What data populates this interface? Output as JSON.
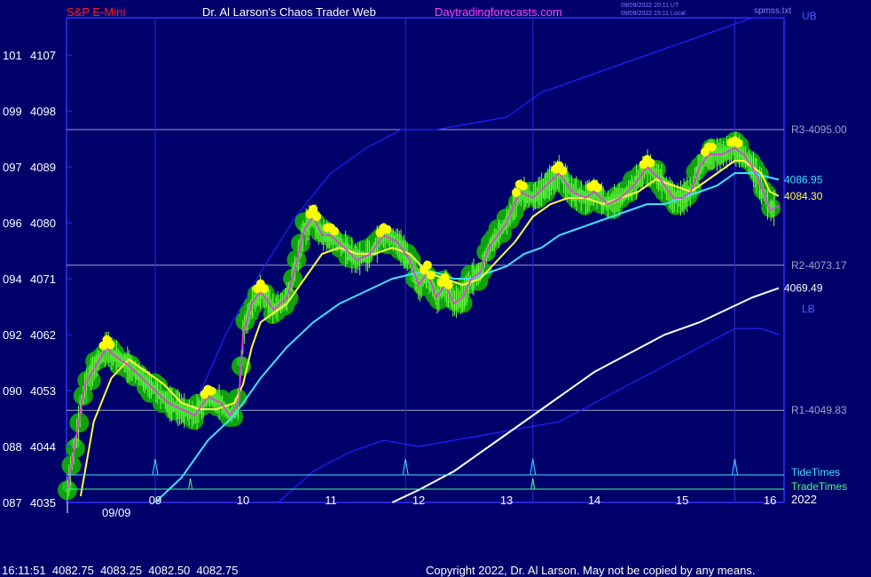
{
  "header": {
    "instrument": "S&P E-Mini",
    "site_title": "Dr. Al Larson's Chaos Trader Web",
    "site_url": "Daytradingforecasts.com",
    "timestamp_ut": "09/09/2022 20:11 UT",
    "timestamp_local": "09/09/2022 15:11 Local",
    "file_name": "spmss.txt",
    "colors": {
      "instrument": "#ff2020",
      "site_title": "#ffffff",
      "site_url": "#ff40ff",
      "timestamps": "#8080ff"
    }
  },
  "footer": {
    "quote": "16:11:51  4082.75  4083.25  4082.50  4082.75",
    "copyright": "Copyright 2022, Dr. Al Larson. May not be copied by any means."
  },
  "chart_data": {
    "type": "line",
    "title": "S&P E-Mini",
    "y_axis": {
      "range": [
        4035,
        4113
      ],
      "tick_labels": [
        {
          "left": "087",
          "price": "4035",
          "value": 4035
        },
        {
          "left": "088",
          "price": "4044",
          "value": 4044
        },
        {
          "left": "090",
          "price": "4053",
          "value": 4053
        },
        {
          "left": "092",
          "price": "4062",
          "value": 4062
        },
        {
          "left": "094",
          "price": "4071",
          "value": 4071
        },
        {
          "left": "096",
          "price": "4080",
          "value": 4080
        },
        {
          "left": "097",
          "price": "4089",
          "value": 4089
        },
        {
          "left": "099",
          "price": "4098",
          "value": 4098
        },
        {
          "left": "101",
          "price": "4107",
          "value": 4107
        }
      ]
    },
    "x_axis": {
      "range": [
        8.0,
        16.1
      ],
      "unit": "hour",
      "tick_labels": [
        {
          "label": "09",
          "value": 9
        },
        {
          "label": "10",
          "value": 10
        },
        {
          "label": "11",
          "value": 11
        },
        {
          "label": "12",
          "value": 12
        },
        {
          "label": "13",
          "value": 13
        },
        {
          "label": "14",
          "value": 14
        },
        {
          "label": "15",
          "value": 15
        },
        {
          "label": "16",
          "value": 16
        }
      ],
      "date_label": "09/09",
      "year_label": "2022"
    },
    "levels": [
      {
        "label": "R3-4095.00",
        "value": 4095.0
      },
      {
        "label": "R2-4073.17",
        "value": 4073.17
      },
      {
        "label": "R1-4049.83",
        "value": 4049.83
      }
    ],
    "vertical_markers": [
      9.0,
      11.85,
      13.3,
      15.6
    ],
    "tide_times": [
      9.0,
      11.85,
      13.3,
      15.6
    ],
    "trade_times": [
      9.4,
      13.3
    ],
    "band_labels": {
      "upper": "UB",
      "lower": "LB"
    },
    "row_labels": {
      "tide": "TideTimes",
      "trade": "TradeTimes"
    },
    "end_values": [
      {
        "label": "4086.95",
        "value": 4086.95,
        "series": "cyan_average"
      },
      {
        "label": "4084.30",
        "value": 4084.3,
        "series": "yellow_average"
      },
      {
        "label": "4069.49",
        "value": 4069.49,
        "series": "white_line"
      }
    ],
    "series": [
      {
        "key": "price",
        "color": "#e040e0",
        "x": [
          8.0,
          8.2,
          8.45,
          8.5,
          8.7,
          8.85,
          9.0,
          9.15,
          9.3,
          9.45,
          9.6,
          9.75,
          9.85,
          9.95,
          10.0,
          10.1,
          10.2,
          10.35,
          10.5,
          10.6,
          10.7,
          10.8,
          10.9,
          11.0,
          11.15,
          11.3,
          11.45,
          11.6,
          11.75,
          11.9,
          12.0,
          12.1,
          12.2,
          12.3,
          12.4,
          12.5,
          12.6,
          12.7,
          12.8,
          12.9,
          13.0,
          13.15,
          13.3,
          13.45,
          13.6,
          13.75,
          13.9,
          14.0,
          14.15,
          14.3,
          14.45,
          14.6,
          14.75,
          14.9,
          15.0,
          15.1,
          15.2,
          15.3,
          15.45,
          15.6,
          15.7,
          15.8,
          15.9,
          16.0,
          16.1
        ],
        "values": [
          4037,
          4054,
          4060,
          4059,
          4057,
          4055,
          4053,
          4051,
          4050,
          4049,
          4052,
          4051,
          4049,
          4051,
          4062,
          4067,
          4069,
          4066,
          4068,
          4073,
          4079,
          4081,
          4078,
          4078,
          4076,
          4074,
          4075,
          4078,
          4077,
          4074,
          4070,
          4072,
          4068,
          4070,
          4067,
          4068,
          4071,
          4072,
          4076,
          4078,
          4080,
          4085,
          4084,
          4086,
          4088,
          4085,
          4084,
          4085,
          4083,
          4084,
          4086,
          4089,
          4087,
          4084,
          4084,
          4085,
          4089,
          4091,
          4091,
          4092,
          4091,
          4089,
          4086,
          4082,
          4082.75
        ]
      },
      {
        "key": "yellow_average",
        "color": "#ffff40",
        "x": [
          8.15,
          8.3,
          8.5,
          8.7,
          8.9,
          9.1,
          9.3,
          9.5,
          9.7,
          9.9,
          10.0,
          10.1,
          10.2,
          10.4,
          10.5,
          10.7,
          10.9,
          11.1,
          11.3,
          11.5,
          11.7,
          11.9,
          12.1,
          12.3,
          12.5,
          12.7,
          12.9,
          13.1,
          13.3,
          13.5,
          13.7,
          13.9,
          14.1,
          14.3,
          14.5,
          14.7,
          14.9,
          15.1,
          15.3,
          15.5,
          15.6,
          15.7,
          15.8,
          15.9,
          16.0,
          16.1
        ],
        "values": [
          4036,
          4048,
          4055,
          4058,
          4056,
          4054,
          4051,
          4050,
          4050,
          4051,
          4054,
          4060,
          4064,
          4066,
          4067,
          4071,
          4075,
          4076,
          4075,
          4075,
          4076,
          4075,
          4072,
          4071,
          4070,
          4071,
          4074,
          4077,
          4081,
          4083,
          4084,
          4084,
          4083,
          4084,
          4085,
          4087,
          4086,
          4085,
          4087,
          4089,
          4090,
          4090,
          4089,
          4088,
          4085,
          4084.3
        ]
      },
      {
        "key": "cyan_average",
        "color": "#40e0ff",
        "x": [
          9.0,
          9.3,
          9.6,
          9.9,
          10.2,
          10.5,
          10.8,
          11.1,
          11.4,
          11.7,
          12.0,
          12.2,
          12.4,
          12.6,
          12.8,
          13.0,
          13.2,
          13.4,
          13.6,
          13.8,
          14.0,
          14.2,
          14.4,
          14.6,
          14.8,
          15.0,
          15.2,
          15.4,
          15.6,
          15.8,
          16.1
        ],
        "values": [
          4035,
          4039,
          4045,
          4049,
          4055,
          4060,
          4064,
          4067,
          4069,
          4071,
          4072,
          4072,
          4071,
          4071,
          4072,
          4073,
          4075,
          4076,
          4078,
          4079,
          4080,
          4081,
          4082,
          4083,
          4083,
          4084,
          4085,
          4086,
          4088,
          4088,
          4086.95
        ]
      },
      {
        "key": "white_line",
        "color": "#ffffff",
        "x": [
          11.7,
          12.0,
          12.4,
          12.8,
          13.2,
          13.6,
          14.0,
          14.4,
          14.8,
          15.2,
          15.5,
          15.8,
          16.1
        ],
        "values": [
          4035,
          4037,
          4040,
          4044,
          4048,
          4052,
          4056,
          4059,
          4062,
          4064,
          4066,
          4068,
          4069.49
        ]
      },
      {
        "key": "upper_band",
        "color": "#2020ff",
        "x": [
          9.4,
          9.8,
          10.2,
          10.6,
          11.0,
          11.4,
          11.8,
          12.2,
          12.6,
          13.0,
          13.4,
          13.8,
          14.2,
          14.6,
          15.0,
          15.4,
          15.8,
          16.1
        ],
        "values": [
          4049,
          4062,
          4072,
          4081,
          4088,
          4092,
          4095,
          4095,
          4096,
          4097,
          4101,
          4103,
          4105,
          4107,
          4109,
          4111,
          4113,
          4113
        ]
      },
      {
        "key": "lower_band",
        "color": "#2020ff",
        "x": [
          10.4,
          10.8,
          11.2,
          11.6,
          12.0,
          12.4,
          12.8,
          13.2,
          13.6,
          14.0,
          14.4,
          14.8,
          15.2,
          15.6,
          15.9,
          16.1
        ],
        "values": [
          4035,
          4040,
          4043,
          4045,
          4044,
          4045,
          4046,
          4047,
          4048,
          4051,
          4054,
          4057,
          4060,
          4063,
          4063,
          4062
        ]
      }
    ]
  }
}
